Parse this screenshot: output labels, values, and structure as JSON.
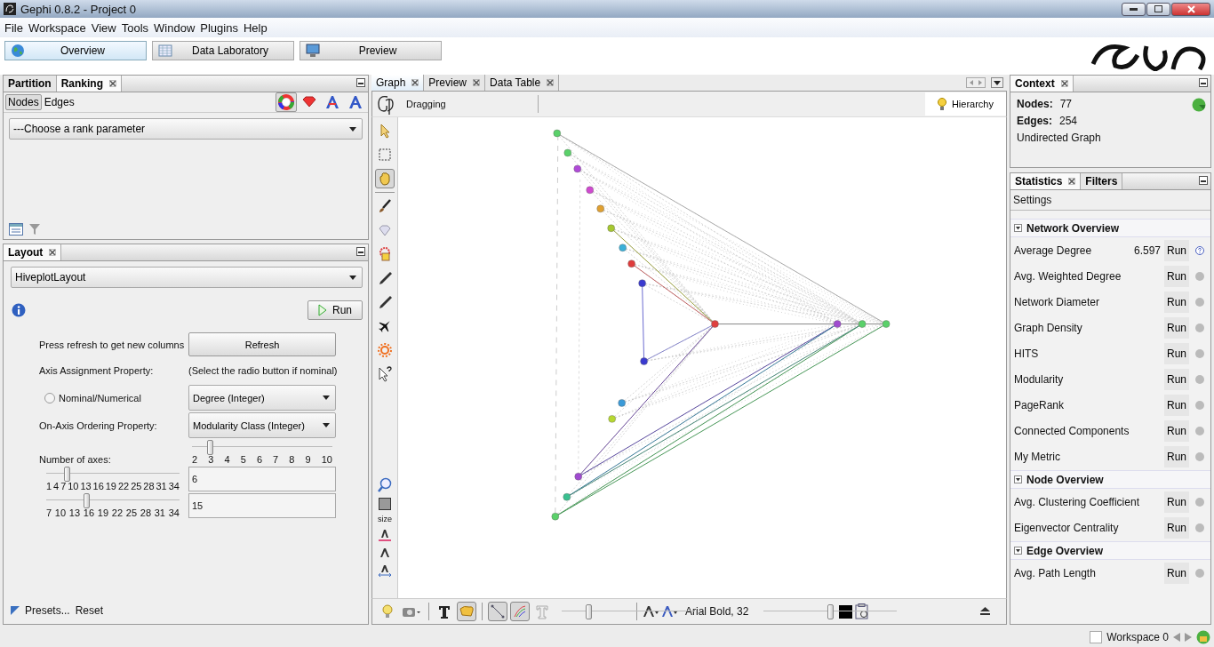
{
  "window": {
    "title": "Gephi 0.8.2 - Project 0"
  },
  "menu": [
    "File",
    "Workspace",
    "View",
    "Tools",
    "Window",
    "Plugins",
    "Help"
  ],
  "workspaces": [
    {
      "label": "Overview",
      "selected": true
    },
    {
      "label": "Data Laboratory",
      "selected": false
    },
    {
      "label": "Preview",
      "selected": false
    }
  ],
  "ranking_panel": {
    "tabs": [
      {
        "label": "Partition",
        "selected": false,
        "closable": false
      },
      {
        "label": "Ranking",
        "selected": true,
        "closable": true
      }
    ],
    "element_tabs": [
      {
        "label": "Nodes",
        "selected": true
      },
      {
        "label": "Edges",
        "selected": false
      }
    ],
    "transformers": [
      {
        "kind": "color",
        "selected": true
      },
      {
        "kind": "size",
        "selected": false
      },
      {
        "kind": "label-color",
        "selected": false
      },
      {
        "kind": "label-size",
        "selected": false
      }
    ],
    "parameter": "---Choose a rank parameter"
  },
  "layout_panel": {
    "tabs": [
      {
        "label": "Layout",
        "selected": true,
        "closable": true
      }
    ],
    "algorithm": "HiveplotLayout",
    "run_button": "Run",
    "refresh_label": "Press refresh to get new columns",
    "refresh_button": "Refresh",
    "axis_label": "Axis Assignment Property:",
    "axis_hint": "(Select the radio button if nominal)",
    "nominal_radio": {
      "label": "Nominal/Numerical",
      "checked": false
    },
    "axis_property": "Degree (Integer)",
    "ordering_label": "On-Axis Ordering Property:",
    "ordering_property": "Modularity Class (Integer)",
    "axes_label": "Number of axes:",
    "axes_slider": {
      "level": 0.125,
      "ticks": [
        "2",
        "3",
        "4",
        "5",
        "6",
        "7",
        "8",
        "9",
        "10"
      ]
    },
    "sliders": [
      {
        "level": 0.15,
        "ticks": [
          "1",
          "4",
          "7",
          "10",
          "13",
          "16",
          "19",
          "22",
          "25",
          "28",
          "31",
          "34"
        ],
        "value": "6"
      },
      {
        "level": 0.3,
        "ticks": [
          "7",
          "10",
          "13",
          "16",
          "19",
          "22",
          "25",
          "28",
          "31",
          "34"
        ],
        "value": "15"
      }
    ],
    "presets": "Presets...",
    "reset": "Reset"
  },
  "graph_panel": {
    "tabs": [
      {
        "label": "Graph",
        "selected": true,
        "closable": true
      },
      {
        "label": "Preview",
        "selected": false,
        "closable": true
      },
      {
        "label": "Data Table",
        "selected": false,
        "closable": true
      }
    ],
    "mode": "Dragging",
    "hierarchy_button": "Hierarchy",
    "tools": [
      {
        "kind": "pointer",
        "selected": false
      },
      {
        "kind": "rectangle",
        "selected": false
      },
      {
        "kind": "hand",
        "selected": true
      },
      {
        "kind": "brush",
        "selected": false
      },
      {
        "kind": "diamond",
        "selected": false
      },
      {
        "kind": "painter",
        "selected": false
      },
      {
        "kind": "pencil",
        "selected": false
      },
      {
        "kind": "pencil",
        "selected": false
      },
      {
        "kind": "airplane",
        "selected": false
      },
      {
        "kind": "sun",
        "selected": false
      },
      {
        "kind": "help-cursor",
        "selected": false
      }
    ],
    "size_label": "size",
    "bottom_tools": [
      {
        "kind": "bulb",
        "selected": false
      },
      {
        "kind": "camera",
        "selected": false
      },
      {
        "kind": "bold-text",
        "selected": false
      },
      {
        "kind": "label-background",
        "selected": true
      },
      {
        "kind": "edge",
        "selected": true
      },
      {
        "kind": "edge-color",
        "selected": true
      },
      {
        "kind": "outline-text",
        "selected": false
      }
    ],
    "edge_scale": {
      "level": 0.2
    },
    "label_font": "Arial Bold, 32",
    "font_scale": {
      "level": 0.5
    }
  },
  "context": {
    "tabs": [
      {
        "label": "Context",
        "selected": true,
        "closable": true
      }
    ],
    "nodes_label": "Nodes:",
    "nodes": "77",
    "edges_label": "Edges:",
    "edges": "254",
    "graph_type": "Undirected Graph"
  },
  "statistics": {
    "tabs": [
      {
        "label": "Statistics",
        "selected": true,
        "closable": true
      },
      {
        "label": "Filters",
        "selected": false,
        "closable": false
      }
    ],
    "settings": "Settings",
    "groups": [
      {
        "title": "Network Overview",
        "expanded": true,
        "items": [
          {
            "name": "Average Degree",
            "value": "6.597",
            "run": "Run"
          },
          {
            "name": "Avg. Weighted Degree",
            "run": "Run"
          },
          {
            "name": "Network Diameter",
            "run": "Run"
          },
          {
            "name": "Graph Density",
            "run": "Run"
          },
          {
            "name": "HITS",
            "run": "Run"
          },
          {
            "name": "Modularity",
            "run": "Run"
          },
          {
            "name": "PageRank",
            "run": "Run"
          },
          {
            "name": "Connected Components",
            "run": "Run"
          },
          {
            "name": "My Metric",
            "run": "Run"
          }
        ]
      },
      {
        "title": "Node Overview",
        "expanded": true,
        "items": [
          {
            "name": "Avg. Clustering Coefficient",
            "run": "Run"
          },
          {
            "name": "Eigenvector Centrality",
            "run": "Run"
          }
        ]
      },
      {
        "title": "Edge Overview",
        "expanded": true,
        "items": [
          {
            "name": "Avg. Path Length",
            "run": "Run"
          }
        ]
      }
    ]
  },
  "status_bar": {
    "workspace": "Workspace 0"
  }
}
